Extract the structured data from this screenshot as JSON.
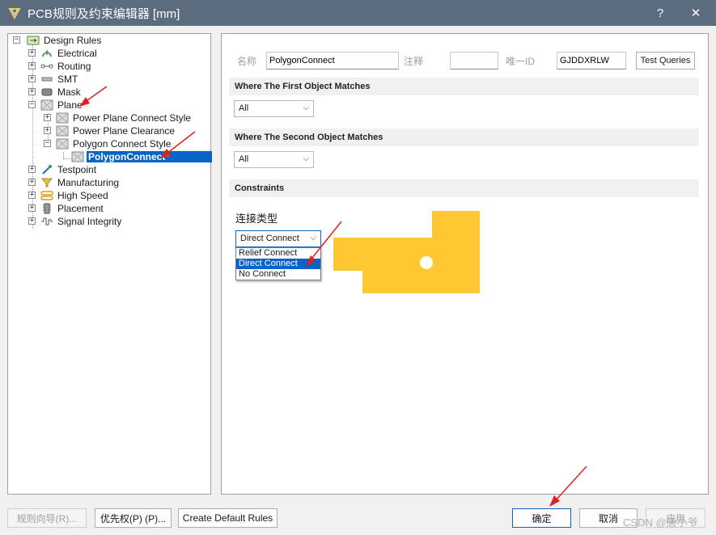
{
  "window": {
    "title": "PCB规则及约束编辑器 [mm]",
    "help_label": "?",
    "close_label": "✕"
  },
  "tree": {
    "root": "Design Rules",
    "items": [
      {
        "label": "Electrical",
        "icon": "electrical-icon"
      },
      {
        "label": "Routing",
        "icon": "routing-icon"
      },
      {
        "label": "SMT",
        "icon": "smt-icon"
      },
      {
        "label": "Mask",
        "icon": "mask-icon"
      },
      {
        "label": "Plane",
        "icon": "plane-icon"
      },
      {
        "label": "Power Plane Connect Style",
        "icon": "rule-icon"
      },
      {
        "label": "Power Plane Clearance",
        "icon": "rule-icon"
      },
      {
        "label": "Polygon Connect Style",
        "icon": "rule-icon"
      },
      {
        "label": "PolygonConnect*",
        "icon": "rule-icon"
      },
      {
        "label": "Testpoint",
        "icon": "testpoint-icon"
      },
      {
        "label": "Manufacturing",
        "icon": "manufacturing-icon"
      },
      {
        "label": "High Speed",
        "icon": "highspeed-icon"
      },
      {
        "label": "Placement",
        "icon": "placement-icon"
      },
      {
        "label": "Signal Integrity",
        "icon": "signal-icon"
      }
    ]
  },
  "rule": {
    "name_label": "名称",
    "name_value": "PolygonConnect",
    "comment_label": "注释",
    "comment_value": "",
    "uid_label": "唯一ID",
    "uid_value": "GJDDXRLW",
    "test_queries": "Test Queries"
  },
  "first_match": {
    "header": "Where The First Object Matches",
    "value": "All"
  },
  "second_match": {
    "header": "Where The Second Object Matches",
    "value": "All"
  },
  "constraints": {
    "header": "Constraints",
    "connect_type_label": "连接类型",
    "selected": "Direct Connect",
    "options": [
      "Relief Connect",
      "Direct Connect",
      "No Connect"
    ],
    "preview_fill_color": "#ffc832"
  },
  "footer": {
    "wizard": "规则向导(R)...",
    "priority": "优先权(P) (P)...",
    "create_default": "Create Default Rules",
    "ok": "确定",
    "cancel": "取消",
    "apply": "应用",
    "watermark": "CSDN @唐小爷"
  }
}
